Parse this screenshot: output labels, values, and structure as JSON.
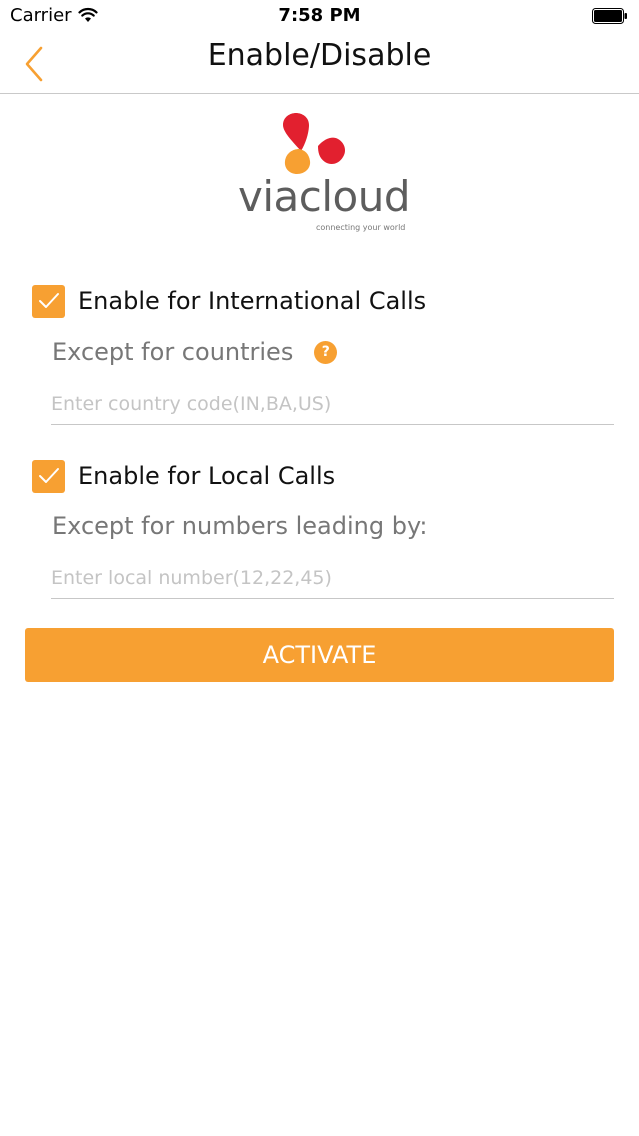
{
  "status_bar": {
    "carrier": "Carrier",
    "time": "7:58 PM"
  },
  "nav": {
    "title": "Enable/Disable",
    "back_icon": "chevron-left-icon"
  },
  "logo": {
    "name": "viacloud",
    "tagline": "connecting your world",
    "colors": [
      "#e2202f",
      "#f7a032"
    ]
  },
  "international": {
    "label": "Enable for International Calls",
    "checked": true,
    "except_label": "Except for countries",
    "help_icon": "question-icon",
    "help_glyph": "?",
    "input_placeholder": "Enter country code(IN,BA,US)",
    "input_value": ""
  },
  "local": {
    "label": "Enable for Local Calls",
    "checked": true,
    "except_label": "Except for numbers leading by:",
    "input_placeholder": "Enter local number(12,22,45)",
    "input_value": ""
  },
  "activate_label": "ACTIVATE",
  "colors": {
    "accent": "#f7a032",
    "logo_red": "#e2202f",
    "text": "#111111",
    "muted": "#777777",
    "placeholder": "#c4c4c4",
    "divider": "#c7c7c7"
  }
}
